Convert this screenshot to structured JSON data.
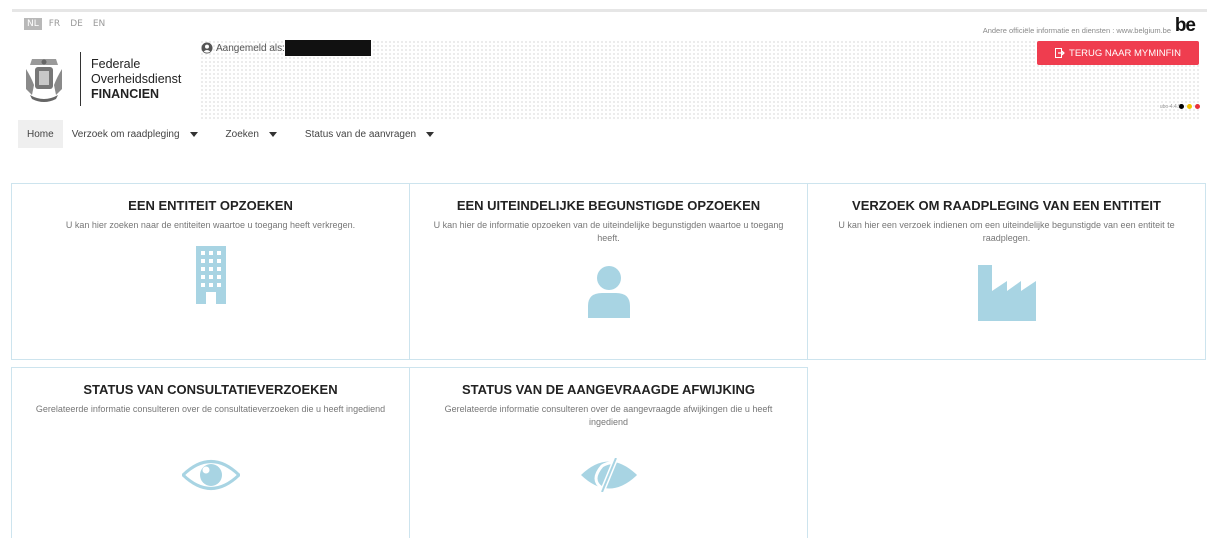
{
  "languages": [
    {
      "code": "NL",
      "active": true
    },
    {
      "code": "FR",
      "active": false
    },
    {
      "code": "DE",
      "active": false
    },
    {
      "code": "EN",
      "active": false
    }
  ],
  "header": {
    "gov_link": "Andere officiële informatie en diensten : www.belgium.be",
    "be_logo": "be",
    "logo_line1": "Federale",
    "logo_line2": "Overheidsdienst",
    "logo_line3": "FINANCIEN",
    "user_label": "Aangemeld als: ",
    "back_button": "TERUG NAAR MYMINFIN",
    "version": "ubo-4.4.5",
    "flag_colors": [
      "#000000",
      "#f2c300",
      "#e8303a"
    ]
  },
  "nav": {
    "home": "Home",
    "items": [
      "Verzoek om raadpleging",
      "Zoeken",
      "Status van de aanvragen"
    ]
  },
  "tiles": [
    {
      "title": "EEN ENTITEIT OPZOEKEN",
      "desc": "U kan hier zoeken naar de entiteiten waartoe u toegang heeft verkregen.",
      "icon": "building-icon"
    },
    {
      "title": "EEN UITEINDELIJKE BEGUNSTIGDE OPZOEKEN",
      "desc": "U kan hier de informatie opzoeken van de uiteindelijke begunstigden waartoe u toegang heeft.",
      "icon": "person-icon"
    },
    {
      "title": "VERZOEK OM RAADPLEGING VAN EEN ENTITEIT",
      "desc": "U kan hier een verzoek indienen om een uiteindelijke begunstigde van een entiteit te raadplegen.",
      "icon": "factory-icon"
    },
    {
      "title": "STATUS VAN CONSULTATIEVERZOEKEN",
      "desc": "Gerelateerde informatie consulteren over de consultatieverzoeken die u heeft ingediend",
      "icon": "eye-icon"
    },
    {
      "title": "STATUS VAN DE AANGEVRAAGDE AFWIJKING",
      "desc": "Gerelateerde informatie consulteren over de aangevraagde afwijkingen die u heeft ingediend",
      "icon": "eye-slash-icon"
    }
  ],
  "colors": {
    "accent": "#ef3d4f",
    "icon": "#a8d4e3",
    "tile_border": "#cde4ee"
  }
}
